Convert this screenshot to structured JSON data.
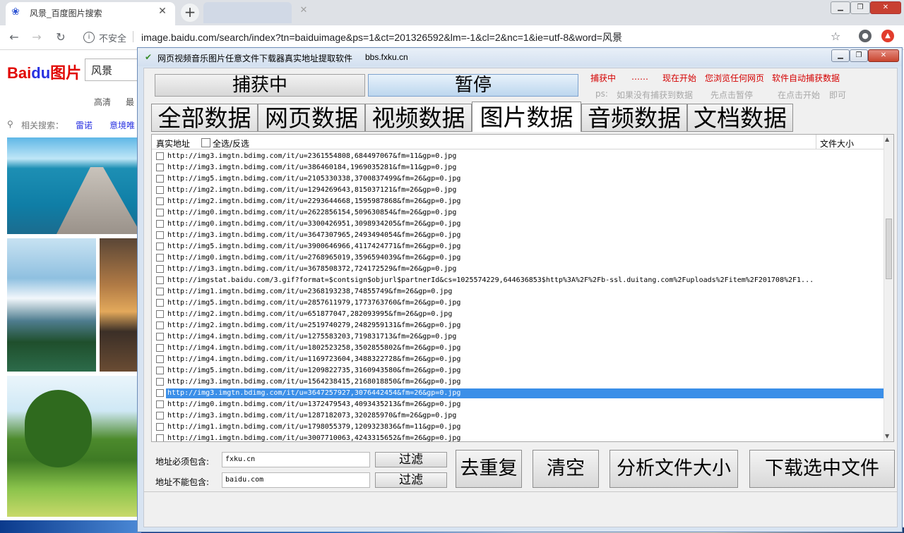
{
  "browser": {
    "tab_title": "风景_百度图片搜索",
    "tab_close": "✕",
    "new_tab": "+",
    "insecure_label": "不安全",
    "url": "image.baidu.com/search/index?tn=baiduimage&ps=1&ct=201326592&lm=-1&cl=2&nc=1&ie=utf-8&word=风景"
  },
  "baidu": {
    "logo_bai": "Bai",
    "logo_du": "du",
    "logo_pic": "图片",
    "search_value": "风景",
    "filter_hd": "高清",
    "filter_latest": "最",
    "related_label": "相关搜索：",
    "related_1": "雷诺",
    "related_2": "意境唯"
  },
  "app": {
    "title": "网页视频音乐图片任意文件下载器真实地址提取软件",
    "title_url": "bbs.fxku.cn",
    "btn_capture": "捕获中",
    "btn_pause": "暂停",
    "hints": {
      "h1": "捕获中",
      "h2": "……",
      "h3": "现在开始",
      "h4": "您浏览任何网页",
      "h5": "软件自动捕获数据",
      "h6": "ps:",
      "h7": "如果没有捕获到数据",
      "h8": "先点击暂停",
      "h9": "在点击开始",
      "h10": "即可"
    },
    "tabs": [
      "全部数据",
      "网页数据",
      "视频数据",
      "图片数据",
      "音频数据",
      "文档数据"
    ],
    "list_header": {
      "url": "真实地址",
      "select_all": "全选/反选",
      "size": "文件大小"
    },
    "rows": [
      "http://img3.imgtn.bdimg.com/it/u=2361554808,684497067&fm=11&gp=0.jpg",
      "http://img3.imgtn.bdimg.com/it/u=386460184,1969035281&fm=11&gp=0.jpg",
      "http://img5.imgtn.bdimg.com/it/u=2105330338,3700837499&fm=26&gp=0.jpg",
      "http://img2.imgtn.bdimg.com/it/u=1294269643,815037121&fm=26&gp=0.jpg",
      "http://img2.imgtn.bdimg.com/it/u=2293644668,1595987868&fm=26&gp=0.jpg",
      "http://img0.imgtn.bdimg.com/it/u=2622856154,509630854&fm=26&gp=0.jpg",
      "http://img0.imgtn.bdimg.com/it/u=3300426951,3098934205&fm=26&gp=0.jpg",
      "http://img3.imgtn.bdimg.com/it/u=3647307965,2493494054&fm=26&gp=0.jpg",
      "http://img5.imgtn.bdimg.com/it/u=3900646966,4117424771&fm=26&gp=0.jpg",
      "http://img0.imgtn.bdimg.com/it/u=2768965019,3596594039&fm=26&gp=0.jpg",
      "http://img3.imgtn.bdimg.com/it/u=3678508372,724172529&fm=26&gp=0.jpg",
      "http://imgstat.baidu.com/3.gif?format=$contsign$objurl$partnerId&cs=1025574229,644636853$http%3A%2F%2Fb-ssl.duitang.com%2Fuploads%2Fitem%2F201708%2F1...",
      "http://img1.imgtn.bdimg.com/it/u=2368193238,74855749&fm=26&gp=0.jpg",
      "http://img5.imgtn.bdimg.com/it/u=2857611979,1773763760&fm=26&gp=0.jpg",
      "http://img2.imgtn.bdimg.com/it/u=651877047,282093995&fm=26&gp=0.jpg",
      "http://img2.imgtn.bdimg.com/it/u=2519740279,2482959131&fm=26&gp=0.jpg",
      "http://img4.imgtn.bdimg.com/it/u=1275583203,719831713&fm=26&gp=0.jpg",
      "http://img4.imgtn.bdimg.com/it/u=1802523258,3502855802&fm=26&gp=0.jpg",
      "http://img4.imgtn.bdimg.com/it/u=1169723604,3488322728&fm=26&gp=0.jpg",
      "http://img5.imgtn.bdimg.com/it/u=1209822735,3160943580&fm=26&gp=0.jpg",
      "http://img3.imgtn.bdimg.com/it/u=1564238415,2168018850&fm=26&gp=0.jpg",
      "http://img3.imgtn.bdimg.com/it/u=3647257927,3076442454&fm=26&gp=0.jpg",
      "http://img0.imgtn.bdimg.com/it/u=1372479543,4093435213&fm=26&gp=0.jpg",
      "http://img3.imgtn.bdimg.com/it/u=1287182073,320285970&fm=26&gp=0.jpg",
      "http://img1.imgtn.bdimg.com/it/u=1798055379,1209323836&fm=11&gp=0.jpg",
      "http://img1.imgtn.bdimg.com/it/u=3007710063,4243315652&fm=26&gp=0.jpg"
    ],
    "selected_row_index": 21,
    "filter_must_label": "地址必须包含:",
    "filter_must_value": "fxku.cn",
    "filter_mustnot_label": "地址不能包含:",
    "filter_mustnot_value": "baidu.com",
    "filter_btn": "过滤",
    "btn_dedupe": "去重复",
    "btn_clear": "清空",
    "btn_analyze": "分析文件大小",
    "btn_download": "下载选中文件"
  },
  "colors": {
    "hint_red": "#d40000",
    "hint_gray": "#a8a8a8",
    "selection_blue": "#3b8fe8",
    "baidu_red": "#e10602",
    "baidu_blue": "#2932e1"
  },
  "icons": {
    "back": "arrow-left-icon",
    "forward": "arrow-right-icon",
    "reload": "reload-icon",
    "info": "info-icon",
    "star": "star-icon",
    "account": "account-icon",
    "app": "download-app-icon"
  }
}
